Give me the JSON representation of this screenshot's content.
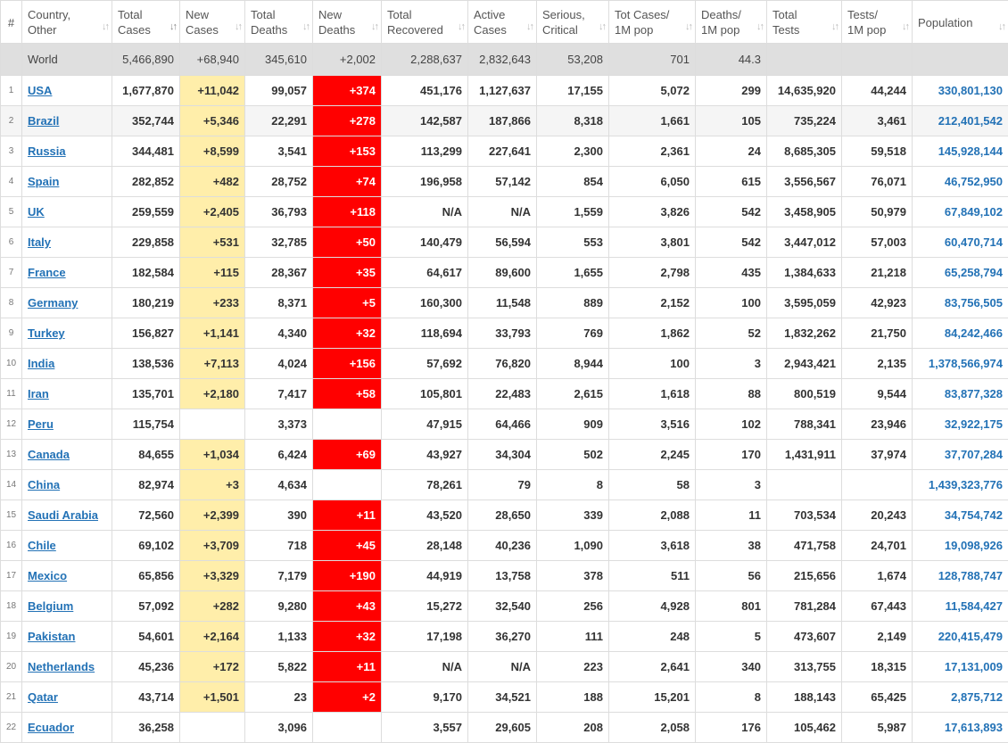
{
  "headers": [
    {
      "label": "#",
      "sort": ""
    },
    {
      "label": "Country,\nOther",
      "sort": "↓↑"
    },
    {
      "label": "Total\nCases",
      "sort": "↓↑"
    },
    {
      "label": "New\nCases",
      "sort": "↓↑"
    },
    {
      "label": "Total\nDeaths",
      "sort": "↓↑"
    },
    {
      "label": "New\nDeaths",
      "sort": "↓↑"
    },
    {
      "label": "Total\nRecovered",
      "sort": "↓↑"
    },
    {
      "label": "Active\nCases",
      "sort": "↓↑"
    },
    {
      "label": "Serious,\nCritical",
      "sort": "↓↑"
    },
    {
      "label": "Tot Cases/\n1M pop",
      "sort": "↓↑"
    },
    {
      "label": "Deaths/\n1M pop",
      "sort": "↓↑"
    },
    {
      "label": "Total\nTests",
      "sort": "↓↑"
    },
    {
      "label": "Tests/\n1M pop",
      "sort": "↓↑"
    },
    {
      "label": "Population",
      "sort": "↓↑"
    }
  ],
  "world": {
    "idx": "",
    "country": "World",
    "total_cases": "5,466,890",
    "new_cases": "+68,940",
    "total_deaths": "345,610",
    "new_deaths": "+2,002",
    "total_recovered": "2,288,637",
    "active_cases": "2,832,643",
    "serious": "53,208",
    "cases_per_m": "701",
    "deaths_per_m": "44.3",
    "total_tests": "",
    "tests_per_m": "",
    "population": ""
  },
  "rows": [
    {
      "idx": "1",
      "country": "USA",
      "total_cases": "1,677,870",
      "new_cases": "+11,042",
      "total_deaths": "99,057",
      "new_deaths": "+374",
      "total_recovered": "451,176",
      "active_cases": "1,127,637",
      "serious": "17,155",
      "cases_per_m": "5,072",
      "deaths_per_m": "299",
      "total_tests": "14,635,920",
      "tests_per_m": "44,244",
      "population": "330,801,130"
    },
    {
      "idx": "2",
      "country": "Brazil",
      "total_cases": "352,744",
      "new_cases": "+5,346",
      "total_deaths": "22,291",
      "new_deaths": "+278",
      "total_recovered": "142,587",
      "active_cases": "187,866",
      "serious": "8,318",
      "cases_per_m": "1,661",
      "deaths_per_m": "105",
      "total_tests": "735,224",
      "tests_per_m": "3,461",
      "population": "212,401,542"
    },
    {
      "idx": "3",
      "country": "Russia",
      "total_cases": "344,481",
      "new_cases": "+8,599",
      "total_deaths": "3,541",
      "new_deaths": "+153",
      "total_recovered": "113,299",
      "active_cases": "227,641",
      "serious": "2,300",
      "cases_per_m": "2,361",
      "deaths_per_m": "24",
      "total_tests": "8,685,305",
      "tests_per_m": "59,518",
      "population": "145,928,144"
    },
    {
      "idx": "4",
      "country": "Spain",
      "total_cases": "282,852",
      "new_cases": "+482",
      "total_deaths": "28,752",
      "new_deaths": "+74",
      "total_recovered": "196,958",
      "active_cases": "57,142",
      "serious": "854",
      "cases_per_m": "6,050",
      "deaths_per_m": "615",
      "total_tests": "3,556,567",
      "tests_per_m": "76,071",
      "population": "46,752,950"
    },
    {
      "idx": "5",
      "country": "UK",
      "total_cases": "259,559",
      "new_cases": "+2,405",
      "total_deaths": "36,793",
      "new_deaths": "+118",
      "total_recovered": "N/A",
      "active_cases": "N/A",
      "serious": "1,559",
      "cases_per_m": "3,826",
      "deaths_per_m": "542",
      "total_tests": "3,458,905",
      "tests_per_m": "50,979",
      "population": "67,849,102"
    },
    {
      "idx": "6",
      "country": "Italy",
      "total_cases": "229,858",
      "new_cases": "+531",
      "total_deaths": "32,785",
      "new_deaths": "+50",
      "total_recovered": "140,479",
      "active_cases": "56,594",
      "serious": "553",
      "cases_per_m": "3,801",
      "deaths_per_m": "542",
      "total_tests": "3,447,012",
      "tests_per_m": "57,003",
      "population": "60,470,714"
    },
    {
      "idx": "7",
      "country": "France",
      "total_cases": "182,584",
      "new_cases": "+115",
      "total_deaths": "28,367",
      "new_deaths": "+35",
      "total_recovered": "64,617",
      "active_cases": "89,600",
      "serious": "1,655",
      "cases_per_m": "2,798",
      "deaths_per_m": "435",
      "total_tests": "1,384,633",
      "tests_per_m": "21,218",
      "population": "65,258,794"
    },
    {
      "idx": "8",
      "country": "Germany",
      "total_cases": "180,219",
      "new_cases": "+233",
      "total_deaths": "8,371",
      "new_deaths": "+5",
      "total_recovered": "160,300",
      "active_cases": "11,548",
      "serious": "889",
      "cases_per_m": "2,152",
      "deaths_per_m": "100",
      "total_tests": "3,595,059",
      "tests_per_m": "42,923",
      "population": "83,756,505"
    },
    {
      "idx": "9",
      "country": "Turkey",
      "total_cases": "156,827",
      "new_cases": "+1,141",
      "total_deaths": "4,340",
      "new_deaths": "+32",
      "total_recovered": "118,694",
      "active_cases": "33,793",
      "serious": "769",
      "cases_per_m": "1,862",
      "deaths_per_m": "52",
      "total_tests": "1,832,262",
      "tests_per_m": "21,750",
      "population": "84,242,466"
    },
    {
      "idx": "10",
      "country": "India",
      "total_cases": "138,536",
      "new_cases": "+7,113",
      "total_deaths": "4,024",
      "new_deaths": "+156",
      "total_recovered": "57,692",
      "active_cases": "76,820",
      "serious": "8,944",
      "cases_per_m": "100",
      "deaths_per_m": "3",
      "total_tests": "2,943,421",
      "tests_per_m": "2,135",
      "population": "1,378,566,974"
    },
    {
      "idx": "11",
      "country": "Iran",
      "total_cases": "135,701",
      "new_cases": "+2,180",
      "total_deaths": "7,417",
      "new_deaths": "+58",
      "total_recovered": "105,801",
      "active_cases": "22,483",
      "serious": "2,615",
      "cases_per_m": "1,618",
      "deaths_per_m": "88",
      "total_tests": "800,519",
      "tests_per_m": "9,544",
      "population": "83,877,328"
    },
    {
      "idx": "12",
      "country": "Peru",
      "total_cases": "115,754",
      "new_cases": "",
      "total_deaths": "3,373",
      "new_deaths": "",
      "total_recovered": "47,915",
      "active_cases": "64,466",
      "serious": "909",
      "cases_per_m": "3,516",
      "deaths_per_m": "102",
      "total_tests": "788,341",
      "tests_per_m": "23,946",
      "population": "32,922,175"
    },
    {
      "idx": "13",
      "country": "Canada",
      "total_cases": "84,655",
      "new_cases": "+1,034",
      "total_deaths": "6,424",
      "new_deaths": "+69",
      "total_recovered": "43,927",
      "active_cases": "34,304",
      "serious": "502",
      "cases_per_m": "2,245",
      "deaths_per_m": "170",
      "total_tests": "1,431,911",
      "tests_per_m": "37,974",
      "population": "37,707,284"
    },
    {
      "idx": "14",
      "country": "China",
      "total_cases": "82,974",
      "new_cases": "+3",
      "total_deaths": "4,634",
      "new_deaths": "",
      "total_recovered": "78,261",
      "active_cases": "79",
      "serious": "8",
      "cases_per_m": "58",
      "deaths_per_m": "3",
      "total_tests": "",
      "tests_per_m": "",
      "population": "1,439,323,776"
    },
    {
      "idx": "15",
      "country": "Saudi Arabia",
      "total_cases": "72,560",
      "new_cases": "+2,399",
      "total_deaths": "390",
      "new_deaths": "+11",
      "total_recovered": "43,520",
      "active_cases": "28,650",
      "serious": "339",
      "cases_per_m": "2,088",
      "deaths_per_m": "11",
      "total_tests": "703,534",
      "tests_per_m": "20,243",
      "population": "34,754,742"
    },
    {
      "idx": "16",
      "country": "Chile",
      "total_cases": "69,102",
      "new_cases": "+3,709",
      "total_deaths": "718",
      "new_deaths": "+45",
      "total_recovered": "28,148",
      "active_cases": "40,236",
      "serious": "1,090",
      "cases_per_m": "3,618",
      "deaths_per_m": "38",
      "total_tests": "471,758",
      "tests_per_m": "24,701",
      "population": "19,098,926"
    },
    {
      "idx": "17",
      "country": "Mexico",
      "total_cases": "65,856",
      "new_cases": "+3,329",
      "total_deaths": "7,179",
      "new_deaths": "+190",
      "total_recovered": "44,919",
      "active_cases": "13,758",
      "serious": "378",
      "cases_per_m": "511",
      "deaths_per_m": "56",
      "total_tests": "215,656",
      "tests_per_m": "1,674",
      "population": "128,788,747"
    },
    {
      "idx": "18",
      "country": "Belgium",
      "total_cases": "57,092",
      "new_cases": "+282",
      "total_deaths": "9,280",
      "new_deaths": "+43",
      "total_recovered": "15,272",
      "active_cases": "32,540",
      "serious": "256",
      "cases_per_m": "4,928",
      "deaths_per_m": "801",
      "total_tests": "781,284",
      "tests_per_m": "67,443",
      "population": "11,584,427"
    },
    {
      "idx": "19",
      "country": "Pakistan",
      "total_cases": "54,601",
      "new_cases": "+2,164",
      "total_deaths": "1,133",
      "new_deaths": "+32",
      "total_recovered": "17,198",
      "active_cases": "36,270",
      "serious": "111",
      "cases_per_m": "248",
      "deaths_per_m": "5",
      "total_tests": "473,607",
      "tests_per_m": "2,149",
      "population": "220,415,479"
    },
    {
      "idx": "20",
      "country": "Netherlands",
      "total_cases": "45,236",
      "new_cases": "+172",
      "total_deaths": "5,822",
      "new_deaths": "+11",
      "total_recovered": "N/A",
      "active_cases": "N/A",
      "serious": "223",
      "cases_per_m": "2,641",
      "deaths_per_m": "340",
      "total_tests": "313,755",
      "tests_per_m": "18,315",
      "population": "17,131,009"
    },
    {
      "idx": "21",
      "country": "Qatar",
      "total_cases": "43,714",
      "new_cases": "+1,501",
      "total_deaths": "23",
      "new_deaths": "+2",
      "total_recovered": "9,170",
      "active_cases": "34,521",
      "serious": "188",
      "cases_per_m": "15,201",
      "deaths_per_m": "8",
      "total_tests": "188,143",
      "tests_per_m": "65,425",
      "population": "2,875,712"
    },
    {
      "idx": "22",
      "country": "Ecuador",
      "total_cases": "36,258",
      "new_cases": "",
      "total_deaths": "3,096",
      "new_deaths": "",
      "total_recovered": "3,557",
      "active_cases": "29,605",
      "serious": "208",
      "cases_per_m": "2,058",
      "deaths_per_m": "176",
      "total_tests": "105,462",
      "tests_per_m": "5,987",
      "population": "17,613,893"
    }
  ],
  "colors": {
    "link": "#2372b6",
    "new_cases_bg": "#ffeeaa",
    "new_deaths_bg": "#ff0000",
    "world_row_bg": "#dfdfdf",
    "border": "#dddddd"
  }
}
